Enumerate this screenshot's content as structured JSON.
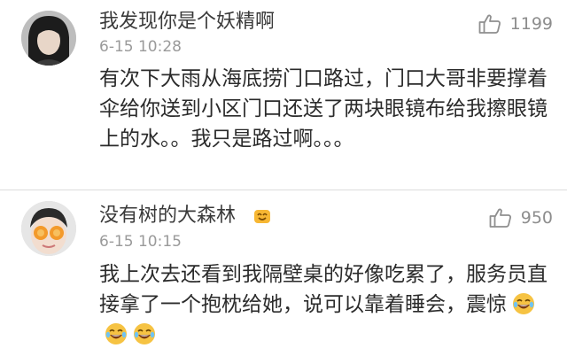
{
  "comments": [
    {
      "username": "我发现你是个妖精啊",
      "time": "6-15 10:28",
      "likes": "1199",
      "text": "有次下大雨从海底捞门口路过，门口大哥非要撑着伞给你送到小区门口还送了两块眼镜布给我擦眼镜上的水。。我只是路过啊。。。",
      "like_icon": "thumbs-up-icon"
    },
    {
      "username": "没有树的大森林",
      "time": "6-15 10:15",
      "likes": "950",
      "text": "我上次去还看到我隔壁桌的好像吃累了，服务员直接拿了一个抱枕给她，说可以靠着睡会，震惊",
      "like_icon": "thumbs-up-icon",
      "badge_icon": "user-badge-icon",
      "emojis": [
        "laugh-cry-emoji",
        "laugh-cry-emoji",
        "laugh-cry-emoji"
      ]
    }
  ]
}
